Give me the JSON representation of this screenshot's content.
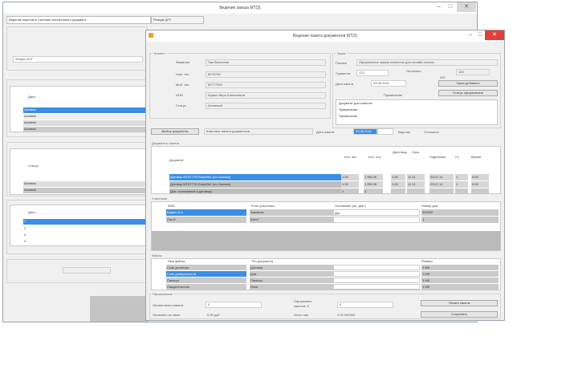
{
  "back_window": {
    "title": "Ведение заказа МТ(3)",
    "tabs": [
      "Ведение пакетов в Системе электронного документ...",
      "Резерв ЦГП"
    ],
    "side_list1": {
      "header": "Дата",
      "rows": [
        "Активно",
        "Активно",
        "Активно",
        "Активно"
      ]
    },
    "side_list2": {
      "header": "Статус",
      "rows": [
        "",
        "Активно",
        "Активно"
      ]
    },
    "side_list3": {
      "header": "Дата",
      "rows": [
        "1",
        "2",
        "3",
        "4"
      ]
    },
    "combo_value": "Запрос БЛГ"
  },
  "front_window": {
    "title": "Ведение пакета документов МТ(3)",
    "client": {
      "group_label": "Клиент",
      "rows": [
        {
          "label": "Фамилия",
          "value": "Пак Вячеслав"
        },
        {
          "label": "Ном. тел.",
          "value": "8978789"
        },
        {
          "label": "Моб. тел.",
          "value": "89777999"
        },
        {
          "label": "ИНН",
          "value": "Шумко Вера Алексеевна"
        },
        {
          "label": "Статус",
          "value": "Активный"
        }
      ]
    },
    "order": {
      "group_label": "Заказ",
      "row1": {
        "label": "Платеж",
        "value": "Оформление заказа клиентом для онлайн-оплаты"
      },
      "row2": {
        "label": "Сумма пл.",
        "value": "123",
        "label2": "Оплачено",
        "value2": "100",
        "value3": "000"
      },
      "row3": {
        "label": "Дата пакета",
        "value": "03.06.2021",
        "button": "Заказ добавлен"
      },
      "row4": {
        "label": "Примечание",
        "button": "Статус оформления"
      },
      "notes": [
        "Документ для клиента",
        "Примечание",
        "Примечание"
      ]
    },
    "filters": {
      "button1": "Выбор документа",
      "input1": "Комплект пакета документов",
      "label2": "Дата пакета",
      "input2": "03.06.2021",
      "label3": "Вид пак.",
      "value3": "Отложено"
    },
    "documents": {
      "group_label": "Документы пакета",
      "headers": [
        "Документ",
        "Кол. экз.",
        "Кол. стр.",
        "Дата выд.",
        "Срок",
        "Подписано",
        "Ст.",
        "Время"
      ],
      "rows": [
        {
          "doc": "Договор МТКТ77Н Бюро№1 (со Сканом)",
          "c1": "1.00",
          "c2": "1 ФВ-08",
          "c3": "1.00",
          "c4": "11 01",
          "c5": "23.07.14",
          "c6": "1",
          "c7": "9:00",
          "selected": true
        },
        {
          "doc": "Договор МТКТ77Н Бюро№1 (со Сканом)",
          "c1": "1.00",
          "c2": "1 ФВ-08",
          "c3": "1.00",
          "c4": "11 01",
          "c5": "23.07.14",
          "c6": "1",
          "c7": "9:00",
          "selected": false
        },
        {
          "doc": "Доп. соглашение к договору",
          "c1": "1",
          "c2": "1",
          "c3": "",
          "c4": "",
          "c5": "",
          "c6": "",
          "c7": "",
          "selected": false
        }
      ]
    },
    "participants": {
      "group_label": "Участники",
      "headers": [
        "ФИО",
        "Роль участника",
        "Основание (пр. дов.)",
        "Номер дов."
      ],
      "rows": [
        {
          "c0": "Шумко В.А.",
          "c1": "Заказчик",
          "c2": "Дог.",
          "c3": "000000",
          "selected": true
        },
        {
          "c0": "Пак В.",
          "c1": "Агент",
          "c2": "",
          "c3": "1",
          "selected": false
        }
      ]
    },
    "files": {
      "group_label": "Файлы",
      "headers": [
        "Имя файла",
        "Тип документа",
        "",
        "Размер"
      ],
      "rows": [
        {
          "c0": "Скан договора",
          "c1": "Договор",
          "c2": "",
          "c3": "2 Мб",
          "selected": false
        },
        {
          "c0": "Скан доверенности",
          "c1": "Дов.",
          "c2": "",
          "c3": "1 Мб",
          "selected": true
        },
        {
          "c0": "Паспорт",
          "c1": "Паспорт",
          "c2": "",
          "c3": "3 Мб",
          "selected": false
        },
        {
          "c0": "Свидетельство",
          "c1": "Иное",
          "c2": "",
          "c3": "1 Мб",
          "selected": false
        }
      ]
    },
    "footer": {
      "group_label": "Оформление",
      "row1_label": "Оплата всего пакета",
      "row1_value": "0",
      "row1_label2": "Оформлено",
      "row1_label2b": "пакетов: 0",
      "row1_value2": "0",
      "row1_button": "Печать пакета",
      "row2_label": "Оплачено за пакет",
      "row2_value": "0.00 руб",
      "row2_label2": "Итого пак.",
      "row2_value2": "0.00 000000",
      "row2_button": "Сохранить"
    }
  }
}
